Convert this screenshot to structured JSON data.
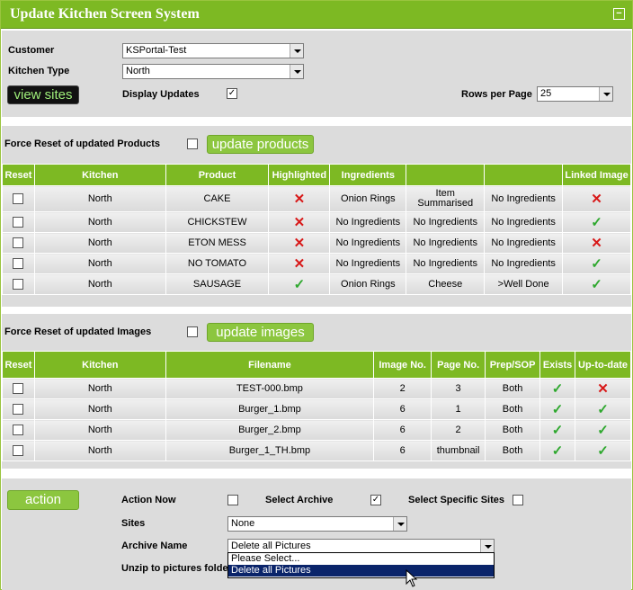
{
  "window": {
    "title": "Update Kitchen Screen System",
    "collapse_symbol": "−"
  },
  "filters": {
    "customer_label": "Customer",
    "customer_value": "KSPortal-Test",
    "kitchen_type_label": "Kitchen Type",
    "kitchen_type_value": "North",
    "view_sites_label": "view sites",
    "display_updates_label": "Display Updates",
    "display_updates_checked": "✓",
    "rows_per_page_label": "Rows per Page",
    "rows_per_page_value": "25"
  },
  "products": {
    "force_reset_label": "Force Reset of updated Products",
    "update_button": "update products",
    "headers": [
      "Reset",
      "Kitchen",
      "Product",
      "Highlighted",
      "Ingredients",
      "",
      "",
      "Linked Image"
    ],
    "rows": [
      {
        "kitchen": "North",
        "product": "CAKE",
        "highlighted": "✕",
        "highlighted_ok": false,
        "ing1": "Onion Rings",
        "ing2": "Item Summarised",
        "ing3": "No Ingredients",
        "linked": "✕",
        "linked_ok": false
      },
      {
        "kitchen": "North",
        "product": "CHICKSTEW",
        "highlighted": "✕",
        "highlighted_ok": false,
        "ing1": "No Ingredients",
        "ing2": "No Ingredients",
        "ing3": "No Ingredients",
        "linked": "✓",
        "linked_ok": true
      },
      {
        "kitchen": "North",
        "product": "ETON MESS",
        "highlighted": "✕",
        "highlighted_ok": false,
        "ing1": "No Ingredients",
        "ing2": "No Ingredients",
        "ing3": "No Ingredients",
        "linked": "✕",
        "linked_ok": false
      },
      {
        "kitchen": "North",
        "product": "NO TOMATO",
        "highlighted": "✕",
        "highlighted_ok": false,
        "ing1": "No Ingredients",
        "ing2": "No Ingredients",
        "ing3": "No Ingredients",
        "linked": "✓",
        "linked_ok": true
      },
      {
        "kitchen": "North",
        "product": "SAUSAGE",
        "highlighted": "✓",
        "highlighted_ok": true,
        "ing1": "Onion Rings",
        "ing2": "Cheese",
        "ing3": ">Well Done",
        "linked": "✓",
        "linked_ok": true
      }
    ]
  },
  "images": {
    "force_reset_label": "Force Reset of updated Images",
    "update_button": "update images",
    "headers": [
      "Reset",
      "Kitchen",
      "Filename",
      "Image No.",
      "Page No.",
      "Prep/SOP",
      "Exists",
      "Up-to-date"
    ],
    "rows": [
      {
        "kitchen": "North",
        "filename": "TEST-000.bmp",
        "image_no": "2",
        "page_no": "3",
        "prep": "Both",
        "exists": "✓",
        "exists_ok": true,
        "uptodate": "✕",
        "uptodate_ok": false
      },
      {
        "kitchen": "North",
        "filename": "Burger_1.bmp",
        "image_no": "6",
        "page_no": "1",
        "prep": "Both",
        "exists": "✓",
        "exists_ok": true,
        "uptodate": "✓",
        "uptodate_ok": true
      },
      {
        "kitchen": "North",
        "filename": "Burger_2.bmp",
        "image_no": "6",
        "page_no": "2",
        "prep": "Both",
        "exists": "✓",
        "exists_ok": true,
        "uptodate": "✓",
        "uptodate_ok": true
      },
      {
        "kitchen": "North",
        "filename": "Burger_1_TH.bmp",
        "image_no": "6",
        "page_no": "thumbnail",
        "prep": "Both",
        "exists": "✓",
        "exists_ok": true,
        "uptodate": "✓",
        "uptodate_ok": true
      }
    ]
  },
  "action": {
    "button_label": "action",
    "action_now_label": "Action Now",
    "select_archive_label": "Select Archive",
    "select_archive_checked": "✓",
    "select_specific_sites_label": "Select Specific Sites",
    "sites_label": "Sites",
    "sites_value": "None",
    "archive_name_label": "Archive Name",
    "archive_name_value": "Delete all Pictures",
    "unzip_label": "Unzip to pictures folde",
    "dropdown_options": [
      "Please Select...",
      "Delete all Pictures"
    ]
  },
  "colors": {
    "accent": "#7db923",
    "panel": "#dcdcdc",
    "error": "#d81818",
    "success": "#2ea82e"
  }
}
